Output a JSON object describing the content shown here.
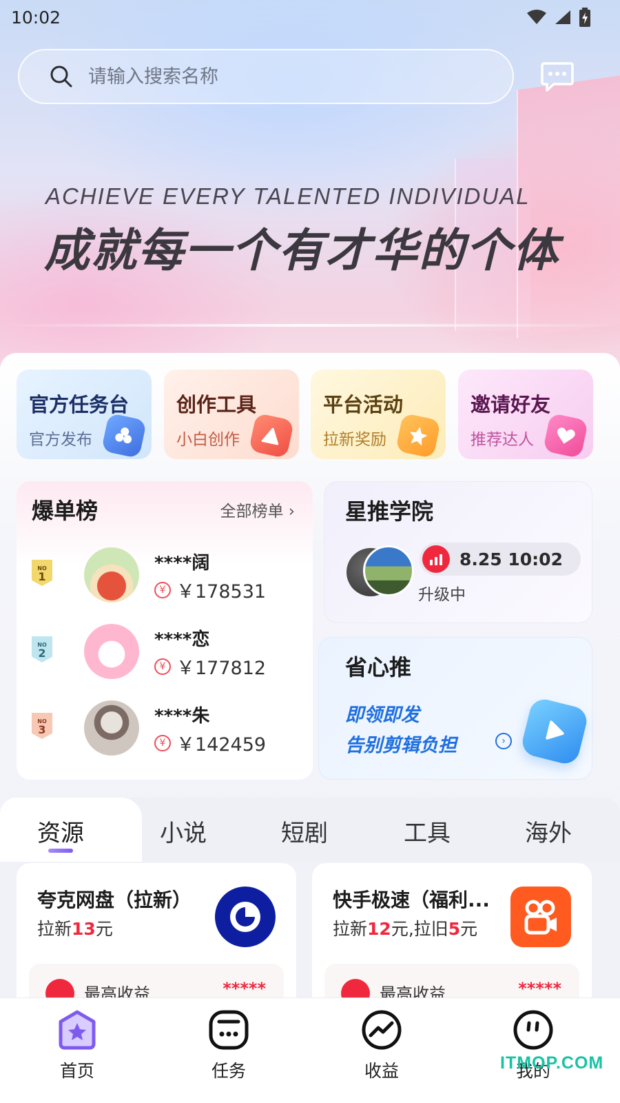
{
  "status_bar": {
    "time": "10:02"
  },
  "search": {
    "placeholder": "请输入搜索名称"
  },
  "banner": {
    "slogan_en": "ACHIEVE EVERY TALENTED INDIVIDUAL",
    "slogan_cn": "成就每一个有才华的个体"
  },
  "quick_entries": [
    {
      "title": "官方任务台",
      "subtitle": "官方发布",
      "icon": "flower-icon"
    },
    {
      "title": "创作工具",
      "subtitle": "小白创作",
      "icon": "play-icon"
    },
    {
      "title": "平台活动",
      "subtitle": "拉新奖励",
      "icon": "star-icon"
    },
    {
      "title": "邀请好友",
      "subtitle": "推荐达人",
      "icon": "heart-icon"
    }
  ],
  "hot_list": {
    "title": "爆单榜",
    "all_link": "全部榜单",
    "rows": [
      {
        "rank": "1",
        "rank_prefix": "NO",
        "name": "****阔",
        "amount": "￥178531"
      },
      {
        "rank": "2",
        "rank_prefix": "NO",
        "name": "****恋",
        "amount": "￥177812"
      },
      {
        "rank": "3",
        "rank_prefix": "NO",
        "name": "****朱",
        "amount": "￥142459"
      }
    ]
  },
  "academy": {
    "title": "星推学院",
    "live_time": "8.25 10:02",
    "status": "升级中"
  },
  "worry_free": {
    "title": "省心推",
    "line1": "即领即发",
    "line2": "告别剪辑负担"
  },
  "category_tabs": [
    {
      "label": "资源",
      "active": true
    },
    {
      "label": "小说",
      "active": false
    },
    {
      "label": "短剧",
      "active": false
    },
    {
      "label": "工具",
      "active": false
    },
    {
      "label": "海外",
      "active": false
    }
  ],
  "resources": [
    {
      "title": "夸克网盘（拉新）",
      "desc_prefix": "拉新",
      "desc_value": "13",
      "desc_suffix": "元",
      "earn_label": "最高收益",
      "earn_value": "*****"
    },
    {
      "title": "快手极速（福利...",
      "desc_prefix": "拉新",
      "desc_value": "12",
      "desc_mid": "元,拉旧",
      "desc_value2": "5",
      "desc_suffix": "元",
      "earn_label": "最高收益",
      "earn_value": "*****"
    }
  ],
  "bottom_nav": [
    {
      "label": "首页",
      "icon": "home-star-icon",
      "active": true
    },
    {
      "label": "任务",
      "icon": "task-icon",
      "active": false
    },
    {
      "label": "收益",
      "icon": "earnings-chart-icon",
      "active": false
    },
    {
      "label": "我的",
      "icon": "profile-face-icon",
      "active": false
    }
  ],
  "watermark": "ITMOP.COM",
  "colors": {
    "accent_red": "#f0283e",
    "accent_blue": "#1f6fe0",
    "active_purple": "#7e5bef"
  }
}
